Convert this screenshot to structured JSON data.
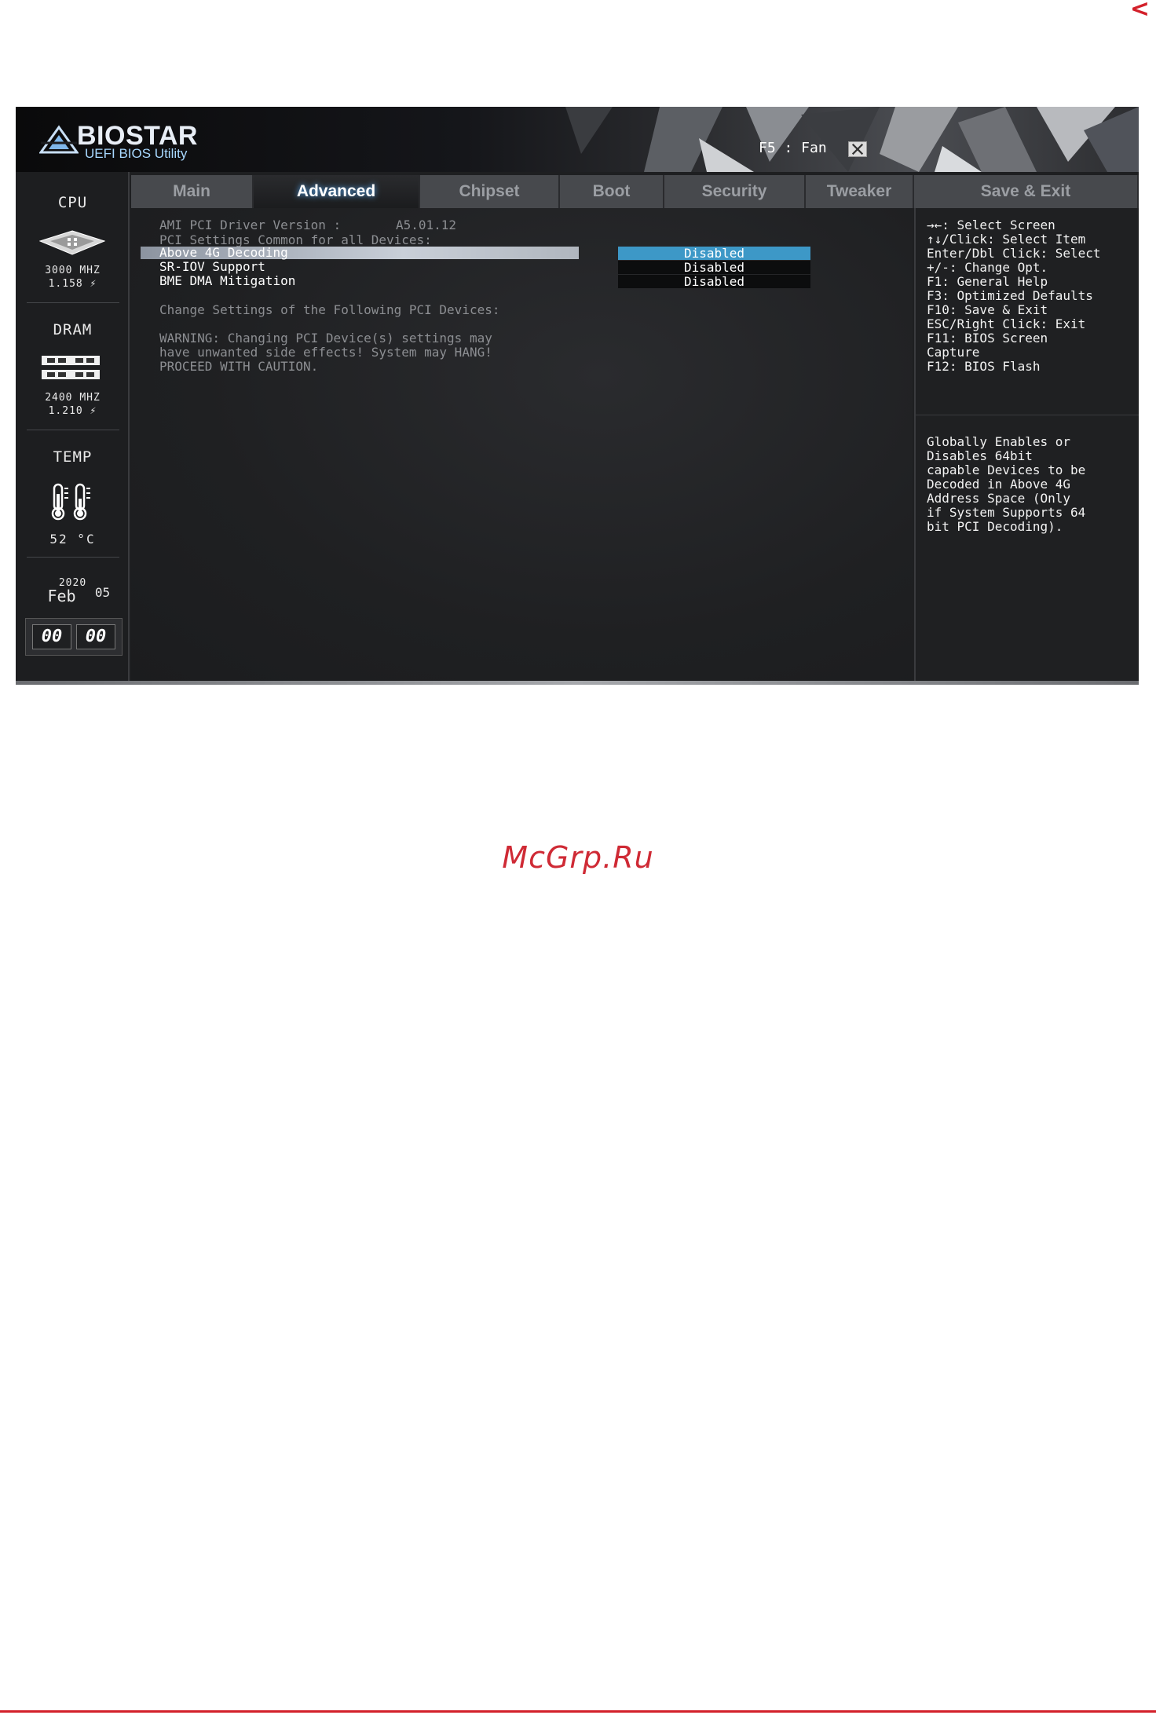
{
  "page": {
    "nav_arrow": "<",
    "watermark": "McGrp.Ru"
  },
  "header": {
    "brand": "BIOSTAR",
    "subtitle": "UEFI BIOS Utility",
    "fan_hint": "F5 : Fan",
    "icons": [
      "biostar-logo-icon",
      "fan-icon"
    ]
  },
  "left_panel": {
    "cpu": {
      "title": "CPU",
      "freq": "3000 MHZ",
      "volt": "1.158 ⚡"
    },
    "dram": {
      "title": "DRAM",
      "freq": "2400 MHZ",
      "volt": "1.210 ⚡"
    },
    "temp": {
      "title": "TEMP",
      "value": "52 °C"
    },
    "date": {
      "year": "2020",
      "month": "Feb",
      "day": "05"
    },
    "time": {
      "hours": "00",
      "minutes": "00"
    }
  },
  "tabs": [
    {
      "label": "Main"
    },
    {
      "label": "Advanced",
      "active": true
    },
    {
      "label": "Chipset"
    },
    {
      "label": "Boot"
    },
    {
      "label": "Security"
    },
    {
      "label": "Tweaker"
    },
    {
      "label": "Save & Exit"
    }
  ],
  "main": {
    "driver_version_label": "AMI PCI Driver Version :",
    "driver_version_value": "A5.01.12",
    "section_common": "PCI Settings Common for all Devices:",
    "settings": [
      {
        "label": "Above 4G Decoding",
        "value": "Disabled",
        "selected": true
      },
      {
        "label": "SR-IOV Support",
        "value": "Disabled"
      },
      {
        "label": "BME DMA Mitigation",
        "value": "Disabled"
      }
    ],
    "section_following": "Change Settings of the Following PCI Devices:",
    "warning": [
      "WARNING: Changing PCI Device(s) settings may",
      "have unwanted side effects! System may HANG!",
      "PROCEED WITH CAUTION."
    ]
  },
  "help": {
    "keys": [
      "→←: Select Screen",
      "↑↓/Click: Select Item",
      "Enter/Dbl Click: Select",
      "+/-: Change Opt.",
      "F1: General Help",
      "F3: Optimized Defaults",
      "F10: Save & Exit",
      "ESC/Right Click: Exit",
      "F11: BIOS Screen",
      "Capture",
      "F12: BIOS Flash"
    ],
    "description": [
      "Globally Enables or",
      "Disables 64bit",
      "capable Devices to be",
      "Decoded in Above 4G",
      "Address Space (Only",
      "if System Supports 64",
      "bit PCI Decoding)."
    ]
  },
  "colors": {
    "accent_red": "#d3202a",
    "selected_value_bg": "#3d98c7",
    "active_tab_glow": "#5ab0ff"
  }
}
